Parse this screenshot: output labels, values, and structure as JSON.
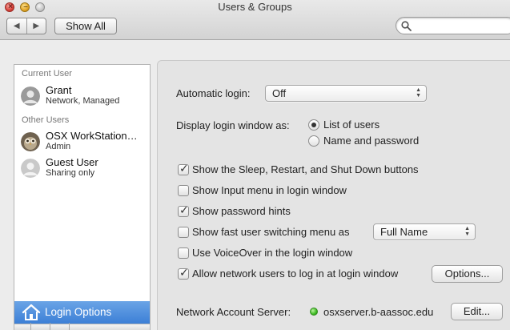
{
  "window": {
    "title": "Users & Groups",
    "close_glyph": "×",
    "minimize_glyph": "–"
  },
  "toolbar": {
    "back_glyph": "◀",
    "forward_glyph": "▶",
    "show_all_label": "Show All",
    "search_placeholder": ""
  },
  "sidebar": {
    "current_user_header": "Current User",
    "other_users_header": "Other Users",
    "current_user": {
      "name": "Grant",
      "subtitle": "Network, Managed",
      "icon": "user-silhouette-icon"
    },
    "other_users": [
      {
        "name": "OSX WorkStation…",
        "subtitle": "Admin",
        "icon": "owl-avatar-icon"
      },
      {
        "name": "Guest User",
        "subtitle": "Sharing only",
        "icon": "user-silhouette-icon"
      }
    ],
    "login_options_label": "Login Options",
    "login_options_icon": "house-icon",
    "selected_color": "#3c7fd6"
  },
  "login_panel": {
    "automatic_login_label": "Automatic login:",
    "automatic_login_value": "Off",
    "display_window_label": "Display login window as:",
    "display_options": [
      {
        "label": "List of users",
        "selected": true
      },
      {
        "label": "Name and password",
        "selected": false
      }
    ],
    "checkboxes": [
      {
        "label": "Show the Sleep, Restart, and Shut Down buttons",
        "checked": true
      },
      {
        "label": "Show Input menu in login window",
        "checked": false
      },
      {
        "label": "Show password hints",
        "checked": true
      },
      {
        "label": "Show fast user switching menu as",
        "checked": false
      },
      {
        "label": "Use VoiceOver in the login window",
        "checked": false
      },
      {
        "label": "Allow network users to log in at login window",
        "checked": true
      }
    ],
    "fast_switching_value": "Full Name",
    "options_button_label": "Options...",
    "network_server_label": "Network Account Server:",
    "network_server_value": "osxserver.b-aassoc.edu",
    "network_status_color": "#3dbb22",
    "edit_button_label": "Edit...",
    "checkmark_glyph": "✓",
    "popup_arrows": "▲▼"
  }
}
